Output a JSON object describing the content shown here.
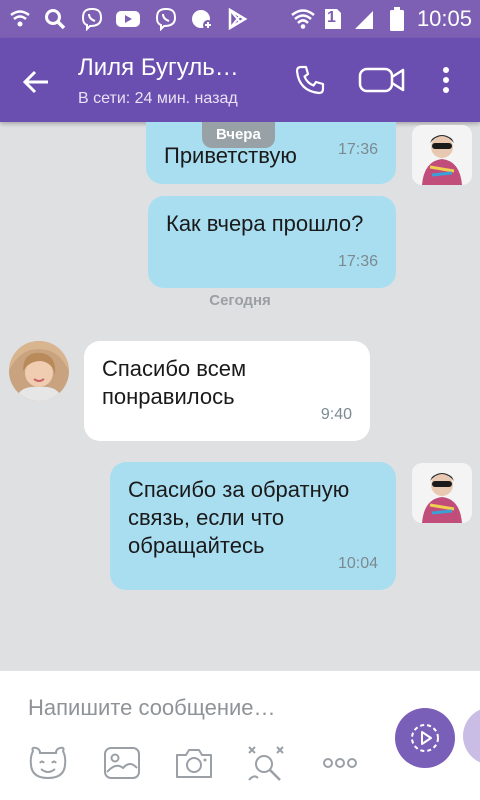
{
  "status_bar": {
    "time": "10:05",
    "sim_slot": "1"
  },
  "header": {
    "title": "Лиля Бугуль…",
    "subtitle": "В сети: 24 мин. назад"
  },
  "chat": {
    "date_yesterday": "Вчера",
    "date_today": "Сегодня",
    "messages": [
      {
        "direction": "outgoing",
        "text": "Приветствую",
        "time": "17:36"
      },
      {
        "direction": "outgoing",
        "text": "Как вчера прошло?",
        "time": "17:36"
      },
      {
        "direction": "incoming",
        "text": "Спасибо всем\nпонравилось",
        "time": "9:40"
      },
      {
        "direction": "outgoing",
        "text": "Спасибо за обратную\nсвязь, если что\nобращайтесь",
        "time": "10:04"
      }
    ]
  },
  "composer": {
    "placeholder": "Напишите сообщение…",
    "tools": [
      "sticker-icon",
      "gallery-icon",
      "camera-icon",
      "doodle-icon",
      "more-icon"
    ]
  },
  "colors": {
    "header": "#6b4fb0",
    "status_bar": "#7d60b4",
    "outgoing_bubble": "#a9def1",
    "incoming_bubble": "#ffffff",
    "chat_background": "#dfe0e2",
    "send_button": "#7a5fb8"
  }
}
